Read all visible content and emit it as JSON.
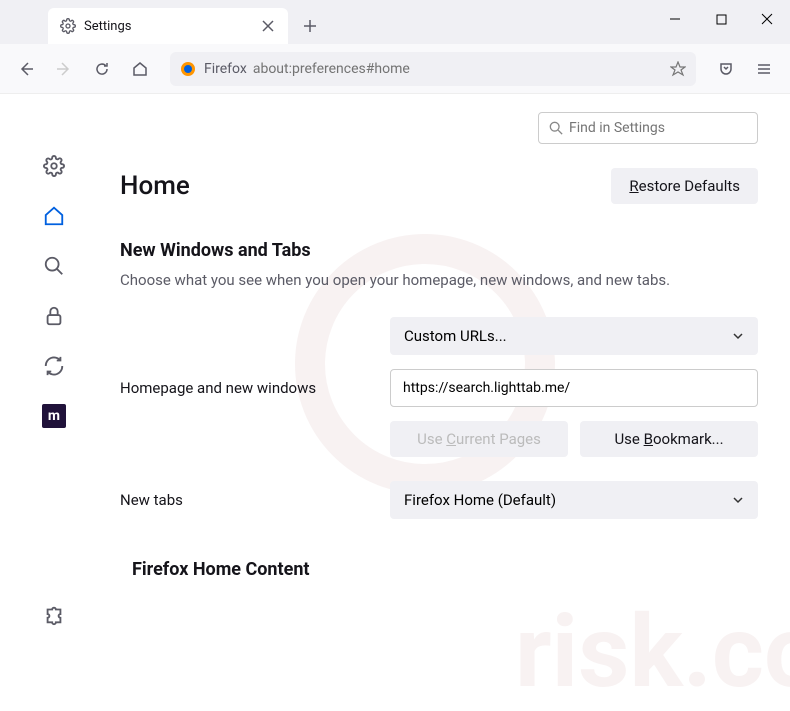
{
  "titlebar": {
    "tab_title": "Settings"
  },
  "toolbar": {
    "url_prefix": "Firefox",
    "url": "about:preferences#home"
  },
  "search": {
    "placeholder": "Find in Settings"
  },
  "header": {
    "title": "Home",
    "restore": "Restore Defaults"
  },
  "section1": {
    "title": "New Windows and Tabs",
    "desc": "Choose what you see when you open your homepage, new windows, and new tabs."
  },
  "homepage": {
    "label": "Homepage and new windows",
    "dropdown": "Custom URLs...",
    "url": "https://search.lighttab.me/",
    "use_current": "Use Current Pages",
    "use_bookmark": "Use Bookmark..."
  },
  "newtabs": {
    "label": "New tabs",
    "dropdown": "Firefox Home (Default)"
  },
  "section2": {
    "title": "Firefox Home Content"
  },
  "sidebar_mzilla": "m"
}
